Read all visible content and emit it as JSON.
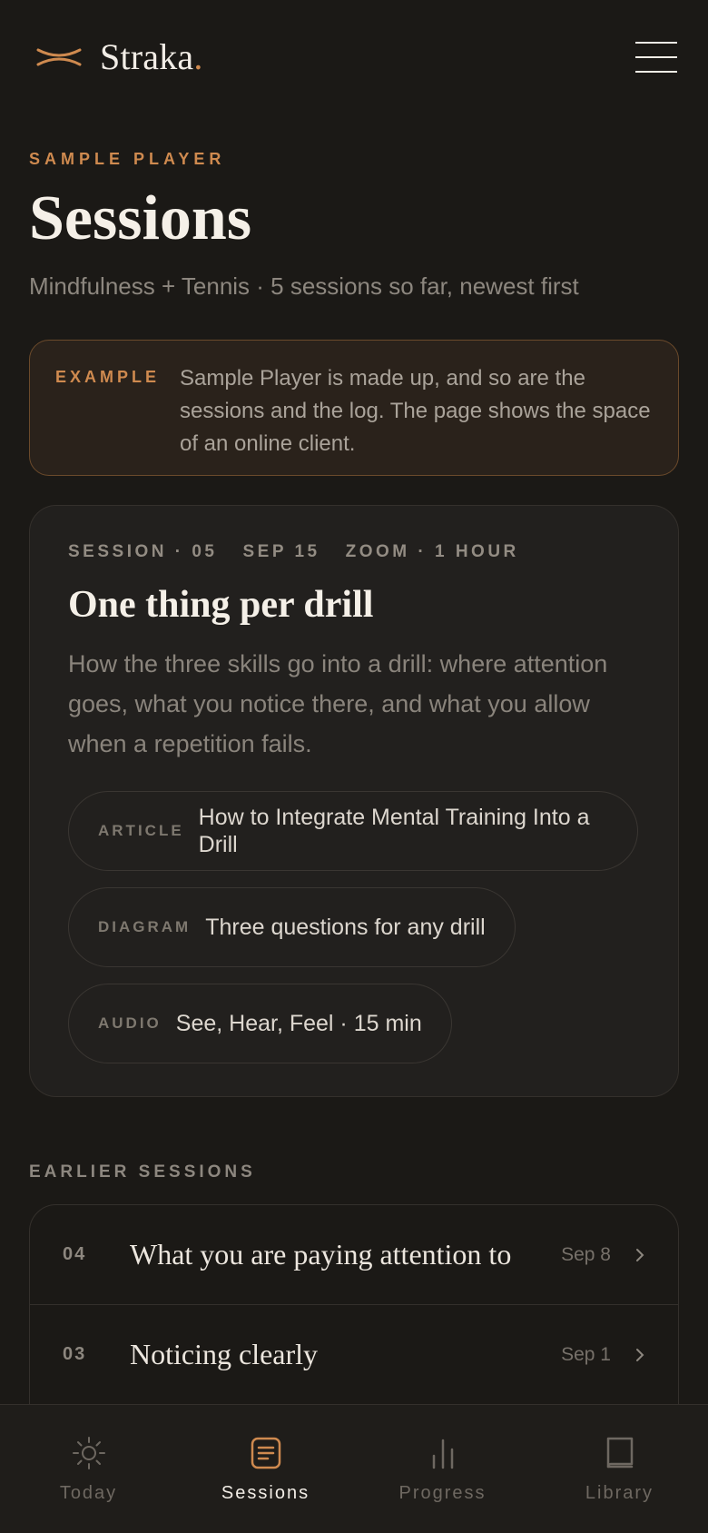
{
  "brand": {
    "name": "Straka",
    "dot": "."
  },
  "page": {
    "eyebrow": "SAMPLE PLAYER",
    "title": "Sessions",
    "subtitle": "Mindfulness + Tennis · 5 sessions so far, newest first"
  },
  "notice": {
    "tag": "EXAMPLE",
    "text": "Sample Player is made up, and so are the sessions and the log. The page shows the space of an online client."
  },
  "current_session": {
    "number": "SESSION · 05",
    "date": "SEP 15",
    "format": "ZOOM · 1 HOUR",
    "title": "One thing per drill",
    "description": "How the three skills go into a drill: where attention goes, what you notice there, and what you allow when a repetition fails.",
    "resources": [
      {
        "tag": "ARTICLE",
        "label": "How to Integrate Mental Training Into a Drill"
      },
      {
        "tag": "DIAGRAM",
        "label": "Three questions for any drill"
      },
      {
        "tag": "AUDIO",
        "label": "See, Hear, Feel · 15 min"
      }
    ]
  },
  "earlier": {
    "label": "EARLIER SESSIONS",
    "items": [
      {
        "num": "04",
        "title": "What you are paying attention to",
        "date": "Sep 8"
      },
      {
        "num": "03",
        "title": "Noticing clearly",
        "date": "Sep 1"
      }
    ]
  },
  "nav": {
    "items": [
      {
        "label": "Today",
        "icon": "sun-icon"
      },
      {
        "label": "Sessions",
        "icon": "document-icon"
      },
      {
        "label": "Progress",
        "icon": "bar-chart-icon"
      },
      {
        "label": "Library",
        "icon": "book-icon"
      }
    ],
    "active": "Sessions"
  },
  "colors": {
    "accent": "#cf8a4f",
    "background": "#1b1916",
    "card": "#22201e",
    "text": "#f2ede6",
    "muted": "#8d877f"
  }
}
